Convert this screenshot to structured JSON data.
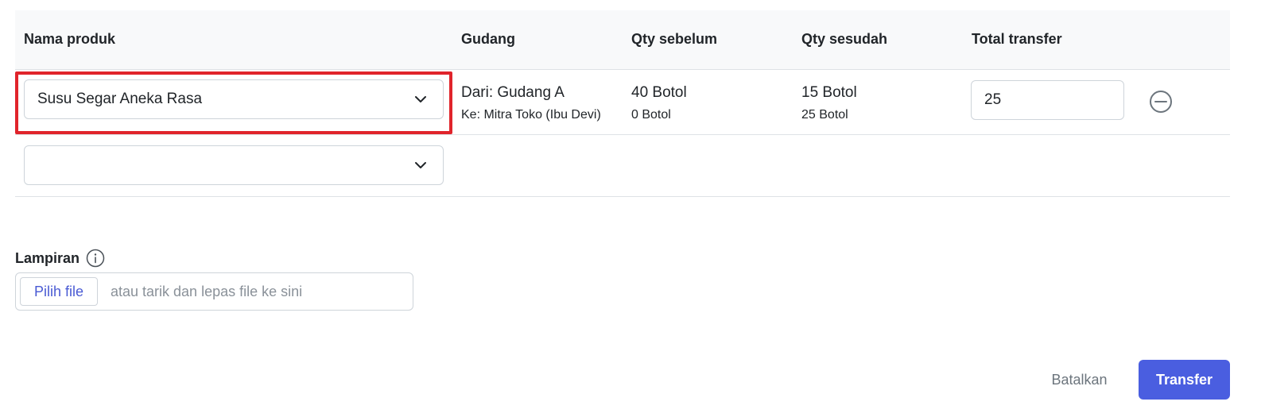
{
  "table": {
    "headers": [
      "Nama produk",
      "Gudang",
      "Qty sebelum",
      "Qty sesudah",
      "Total transfer"
    ],
    "rows": [
      {
        "product": "Susu Segar Aneka Rasa",
        "warehouse_from": "Dari: Gudang A",
        "warehouse_to": "Ke: Mitra Toko (Ibu Devi)",
        "qty_before_from": "40 Botol",
        "qty_before_to": "0 Botol",
        "qty_after_from": "15 Botol",
        "qty_after_to": "25 Botol",
        "total_transfer": "25"
      },
      {
        "product": ""
      }
    ]
  },
  "attachment": {
    "label": "Lampiran",
    "choose_file_label": "Pilih file",
    "placeholder": "atau tarik dan lepas file ke sini"
  },
  "actions": {
    "cancel_label": "Batalkan",
    "transfer_label": "Transfer"
  },
  "icons": {
    "dropdown": "chevron-down-icon",
    "remove": "minus-circle-icon",
    "info": "info-icon"
  },
  "colors": {
    "primary": "#4a5ee0",
    "highlight": "#e0242b"
  }
}
